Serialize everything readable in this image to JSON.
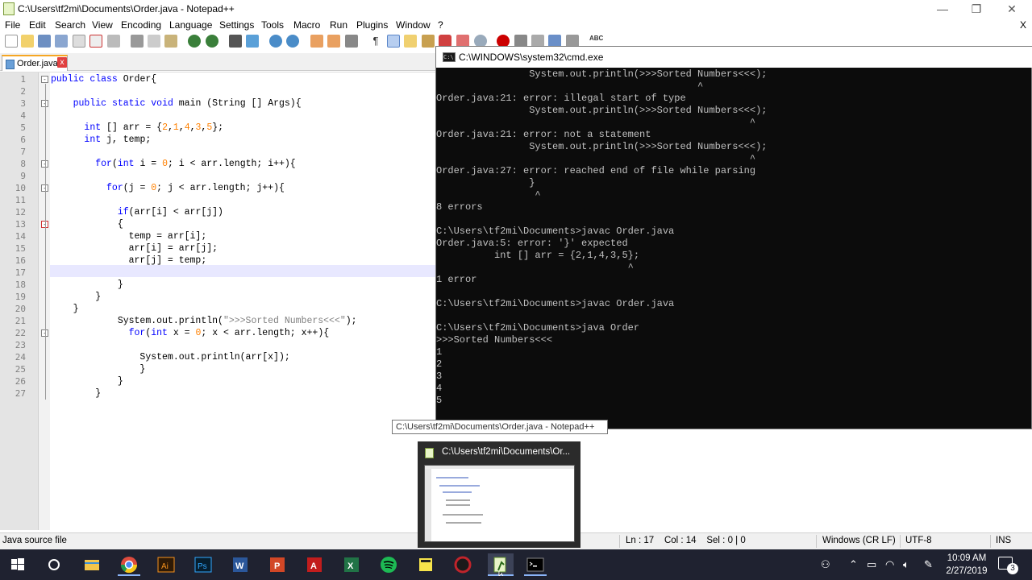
{
  "npp": {
    "title": "C:\\Users\\tf2mi\\Documents\\Order.java - Notepad++",
    "menu": [
      "File",
      "Edit",
      "Search",
      "View",
      "Encoding",
      "Language",
      "Settings",
      "Tools",
      "Macro",
      "Run",
      "Plugins",
      "Window",
      "?"
    ],
    "menu_close": "X",
    "tab_label": "Order.java",
    "tab_close": "x",
    "lines": [
      {
        "n": "1",
        "code": "public class Order{"
      },
      {
        "n": "2",
        "code": ""
      },
      {
        "n": "3",
        "code": "    public static void main (String [] Args){"
      },
      {
        "n": "4",
        "code": ""
      },
      {
        "n": "5",
        "code": "      int [] arr = {2,1,4,3,5};"
      },
      {
        "n": "6",
        "code": "      int j, temp;"
      },
      {
        "n": "7",
        "code": ""
      },
      {
        "n": "8",
        "code": "        for(int i = 0; i < arr.length; i++){"
      },
      {
        "n": "9",
        "code": ""
      },
      {
        "n": "10",
        "code": "          for(j = 0; j < arr.length; j++){"
      },
      {
        "n": "11",
        "code": ""
      },
      {
        "n": "12",
        "code": "            if(arr[i] < arr[j])"
      },
      {
        "n": "13",
        "code": "            {"
      },
      {
        "n": "14",
        "code": "              temp = arr[i];"
      },
      {
        "n": "15",
        "code": "              arr[i] = arr[j];"
      },
      {
        "n": "16",
        "code": "              arr[j] = temp;"
      },
      {
        "n": "17",
        "code": ""
      },
      {
        "n": "18",
        "code": "            }"
      },
      {
        "n": "19",
        "code": "        }"
      },
      {
        "n": "20",
        "code": "    }"
      },
      {
        "n": "21",
        "code": "            System.out.println(\">>>Sorted Numbers<<<\");"
      },
      {
        "n": "22",
        "code": "              for(int x = 0; x < arr.length; x++){"
      },
      {
        "n": "23",
        "code": ""
      },
      {
        "n": "24",
        "code": "                System.out.println(arr[x]);"
      },
      {
        "n": "25",
        "code": "                }"
      },
      {
        "n": "26",
        "code": "            }"
      },
      {
        "n": "27",
        "code": "        }"
      }
    ]
  },
  "cmd": {
    "title": "C:\\WINDOWS\\system32\\cmd.exe",
    "icon_text": "C:\\",
    "lines": [
      "                System.out.println(>>>Sorted Numbers<<<);",
      "                                             ^",
      "Order.java:21: error: illegal start of type",
      "                System.out.println(>>>Sorted Numbers<<<);",
      "                                                      ^",
      "Order.java:21: error: not a statement",
      "                System.out.println(>>>Sorted Numbers<<<);",
      "                                                      ^",
      "Order.java:27: error: reached end of file while parsing",
      "                }",
      "                 ^",
      "8 errors",
      "",
      "C:\\Users\\tf2mi\\Documents>javac Order.java",
      "Order.java:5: error: '}' expected",
      "          int [] arr = {2,1,4,3,5};",
      "                                 ^",
      "1 error",
      "",
      "C:\\Users\\tf2mi\\Documents>javac Order.java",
      "",
      "C:\\Users\\tf2mi\\Documents>java Order",
      ">>>Sorted Numbers<<<",
      "1",
      "2",
      "3",
      "4",
      "5"
    ]
  },
  "tooltip": "C:\\Users\\tf2mi\\Documents\\Order.java - Notepad++",
  "thumbnail_title": "C:\\Users\\tf2mi\\Documents\\Or...",
  "status": {
    "filetype": "Java source file",
    "position": "Ln : 17    Col : 14    Sel : 0 | 0",
    "eol": "Windows (CR LF)",
    "encoding": "UTF-8",
    "mode": "INS"
  },
  "clock": {
    "time": "10:09 AM",
    "date": "2/27/2019"
  },
  "notifications": "3",
  "taskbar_apps": [
    "windows-start",
    "cortana",
    "file-explorer",
    "chrome",
    "illustrator",
    "photoshop",
    "word",
    "powerpoint",
    "acrobat",
    "excel",
    "spotify",
    "sticky-notes",
    "app-red",
    "notepadpp",
    "cmd"
  ],
  "colors": {
    "keyword": "#0000ff",
    "number": "#ff8000",
    "string": "#808080",
    "cmd_bg": "#0c0c0c",
    "cmd_text": "#c0c0c0",
    "taskbar": "#1f2230"
  }
}
